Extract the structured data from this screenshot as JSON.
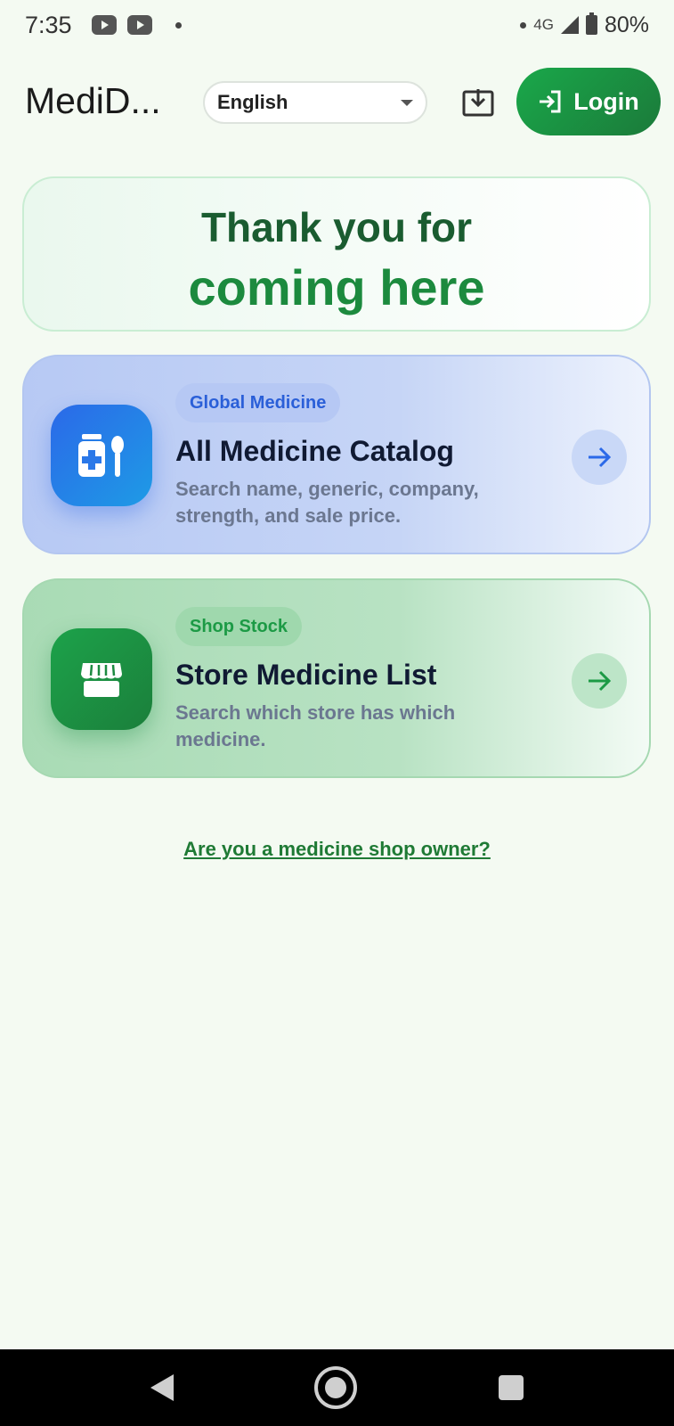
{
  "status_bar": {
    "time": "7:35",
    "network": "4G",
    "battery": "80%"
  },
  "header": {
    "app_title": "MediD...",
    "language": "English",
    "login_label": "Login"
  },
  "welcome": {
    "line1": "Thank you for",
    "line2": "coming here"
  },
  "cards": [
    {
      "badge": "Global Medicine",
      "title": "All Medicine Catalog",
      "description": "Search name, generic, company, strength, and sale price.",
      "icon": "medicine-bottle-spoon-icon",
      "accent": "#2b69e8"
    },
    {
      "badge": "Shop Stock",
      "title": "Store Medicine List",
      "description": "Search which store has which medicine.",
      "icon": "storefront-icon",
      "accent": "#1ca24a"
    }
  ],
  "owner_link": "Are you a medicine shop owner?"
}
